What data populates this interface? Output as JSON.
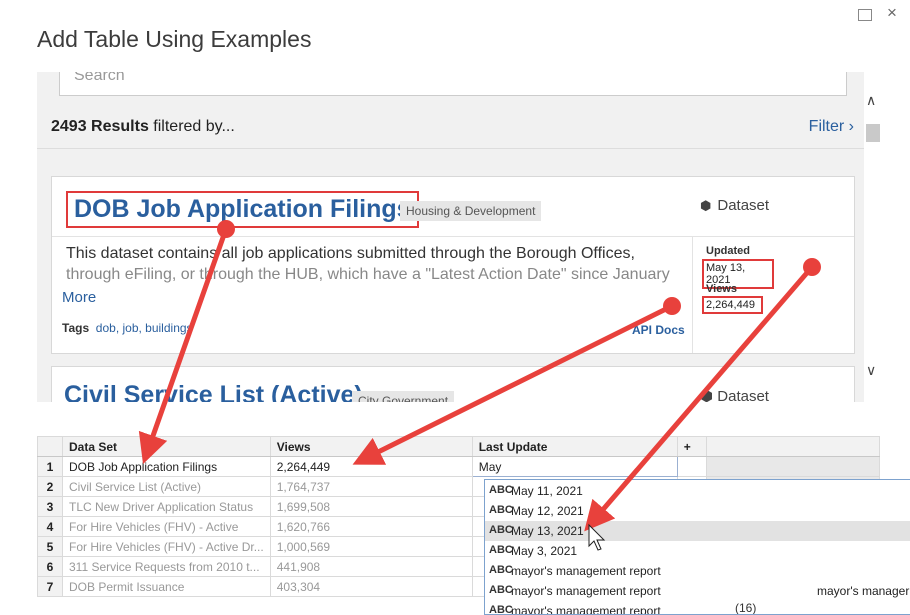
{
  "window": {
    "title": "Add Table Using Examples",
    "maximize_icon": "□",
    "close_icon": "×"
  },
  "search": {
    "placeholder": "Search"
  },
  "results": {
    "count": "2493 Results",
    "suffix": " filtered by...",
    "filter_label": "Filter ›"
  },
  "card1": {
    "title": "DOB Job Application Filings",
    "category": "Housing & Development",
    "type_icon": "dataset-icon",
    "type_label": "Dataset",
    "description_line1": "This dataset contains all job applications submitted through the Borough Offices,",
    "description_line2": "through eFiling, or through the HUB, which have a \"Latest Action Date\" since January",
    "more_label": "More",
    "tags_label": "Tags",
    "tags": "dob, job, buildings",
    "api_docs": "API Docs",
    "updated_label": "Updated",
    "updated_value": "May 13, 2021",
    "views_label": "Views",
    "views_value": "2,264,449"
  },
  "card2": {
    "title": "Civil Service List (Active)",
    "category": "City Government",
    "type_label": "Dataset"
  },
  "grid": {
    "headers": [
      "Data Set",
      "Views",
      "Last Update",
      "+"
    ],
    "rows": [
      {
        "n": "1",
        "name": "DOB Job Application Filings",
        "views": "2,264,449",
        "update": "May"
      },
      {
        "n": "2",
        "name": "Civil Service List (Active)",
        "views": "1,764,737",
        "update": ""
      },
      {
        "n": "3",
        "name": "TLC New Driver Application Status",
        "views": "1,699,508",
        "update": ""
      },
      {
        "n": "4",
        "name": "For Hire Vehicles (FHV) - Active",
        "views": "1,620,766",
        "update": ""
      },
      {
        "n": "5",
        "name": "For Hire Vehicles (FHV) - Active Dr...",
        "views": "1,000,569",
        "update": ""
      },
      {
        "n": "6",
        "name": "311 Service Requests from 2010 t...",
        "views": "441,908",
        "update": ""
      },
      {
        "n": "7",
        "name": "DOB Permit Issuance",
        "views": "403,304",
        "update": ""
      }
    ]
  },
  "dropdown": {
    "type_glyph": "ABC",
    "items": [
      {
        "text": "May 11, 2021",
        "extra": ""
      },
      {
        "text": "May 12, 2021",
        "extra": ""
      },
      {
        "text": "May 13, 2021",
        "extra": ""
      },
      {
        "text": "May 3, 2021",
        "extra": ""
      },
      {
        "text": "mayor's management report",
        "extra": ""
      },
      {
        "text": "mayor's management report",
        "extra": "mayor's manager"
      },
      {
        "text": "mayor's management report",
        "extra": ""
      }
    ],
    "count_label": "(16)"
  },
  "colors": {
    "link_blue": "#2a5f9e",
    "highlight_red": "#e03a3a",
    "arrow_red": "#e8413c"
  }
}
